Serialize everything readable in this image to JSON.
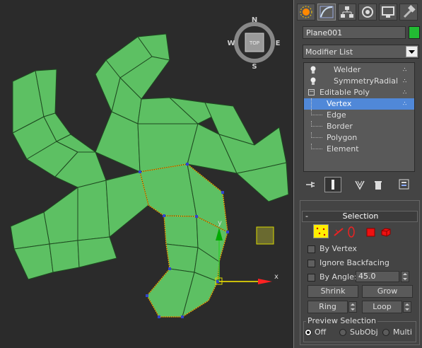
{
  "viewport": {
    "background": "#2b2b2b",
    "mesh_color": "#5dc063",
    "edge_color": "#1a3d1c",
    "selection_edge_color": "#ff9900",
    "vertex_color": "#3344cc",
    "compass": {
      "top_label": "TOP",
      "north": "N",
      "south": "S",
      "east": "E",
      "west": "W"
    },
    "gizmo": {
      "x_label": "x",
      "y_label": "y"
    }
  },
  "panel": {
    "tabs": [
      {
        "name": "create",
        "icon": "create-sun-icon"
      },
      {
        "name": "modify",
        "icon": "modify-curve-icon"
      },
      {
        "name": "hierarchy",
        "icon": "hierarchy-icon"
      },
      {
        "name": "motion",
        "icon": "motion-icon"
      },
      {
        "name": "display",
        "icon": "display-monitor-icon"
      },
      {
        "name": "utilities",
        "icon": "hammer-icon"
      }
    ],
    "object_name": "Plane001",
    "object_color": "#22bb33",
    "modifier_list_label": "Modifier List",
    "stack": [
      {
        "label": "Welder",
        "type": "modifier",
        "selected": false
      },
      {
        "label": "SymmetryRadial",
        "type": "modifier",
        "selected": false
      },
      {
        "label": "Editable Poly",
        "type": "base",
        "selected": false
      },
      {
        "label": "Vertex",
        "type": "sub",
        "selected": true
      },
      {
        "label": "Edge",
        "type": "sub",
        "selected": false
      },
      {
        "label": "Border",
        "type": "sub",
        "selected": false
      },
      {
        "label": "Polygon",
        "type": "sub",
        "selected": false
      },
      {
        "label": "Element",
        "type": "sub",
        "selected": false
      }
    ],
    "selection_rollout": {
      "collapse_symbol": "-",
      "title": "Selection",
      "by_vertex": "By Vertex",
      "ignore_backfacing": "Ignore Backfacing",
      "by_angle": "By Angle:",
      "angle_value": "45.0",
      "shrink": "Shrink",
      "grow": "Grow",
      "ring": "Ring",
      "loop": "Loop",
      "preview_title": "Preview Selection",
      "preview_off": "Off",
      "preview_subobj": "SubObj",
      "preview_multi": "Multi"
    }
  }
}
